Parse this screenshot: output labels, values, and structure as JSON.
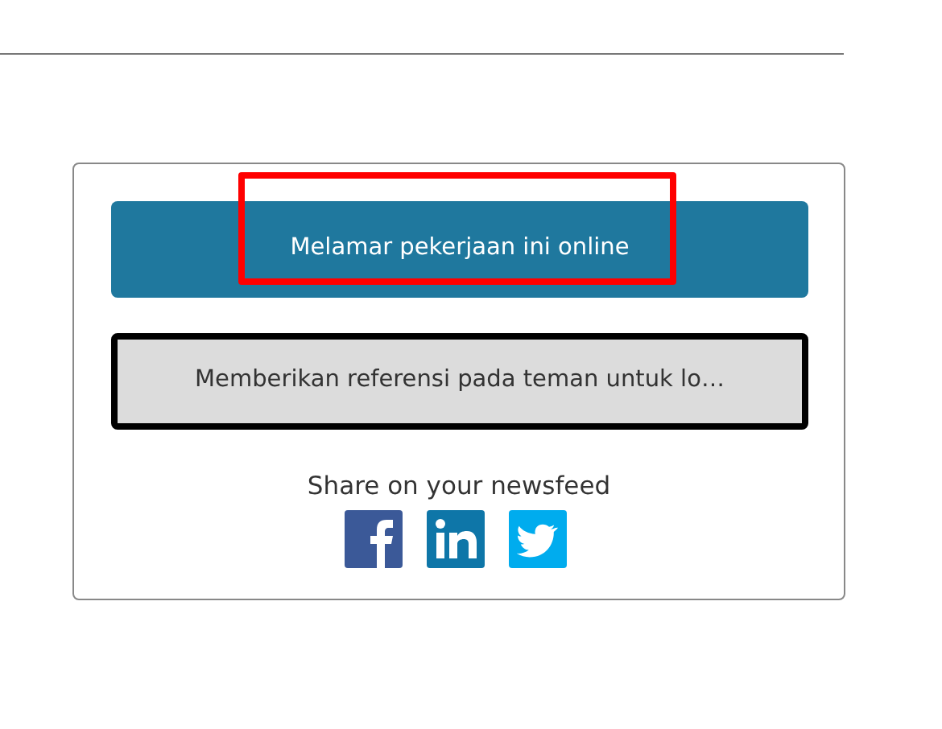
{
  "actions": [
    {
      "kind": "primary",
      "label": "Melamar pekerjaan ini online",
      "highlighted": true,
      "focused": false
    },
    {
      "kind": "secondary",
      "label": "Memberikan referensi pada teman untuk lo…",
      "highlighted": false,
      "focused": true
    }
  ],
  "share": {
    "label": "Share on your newsfeed",
    "networks": [
      {
        "kind": "facebook"
      },
      {
        "kind": "linkedin"
      },
      {
        "kind": "twitter"
      }
    ]
  }
}
